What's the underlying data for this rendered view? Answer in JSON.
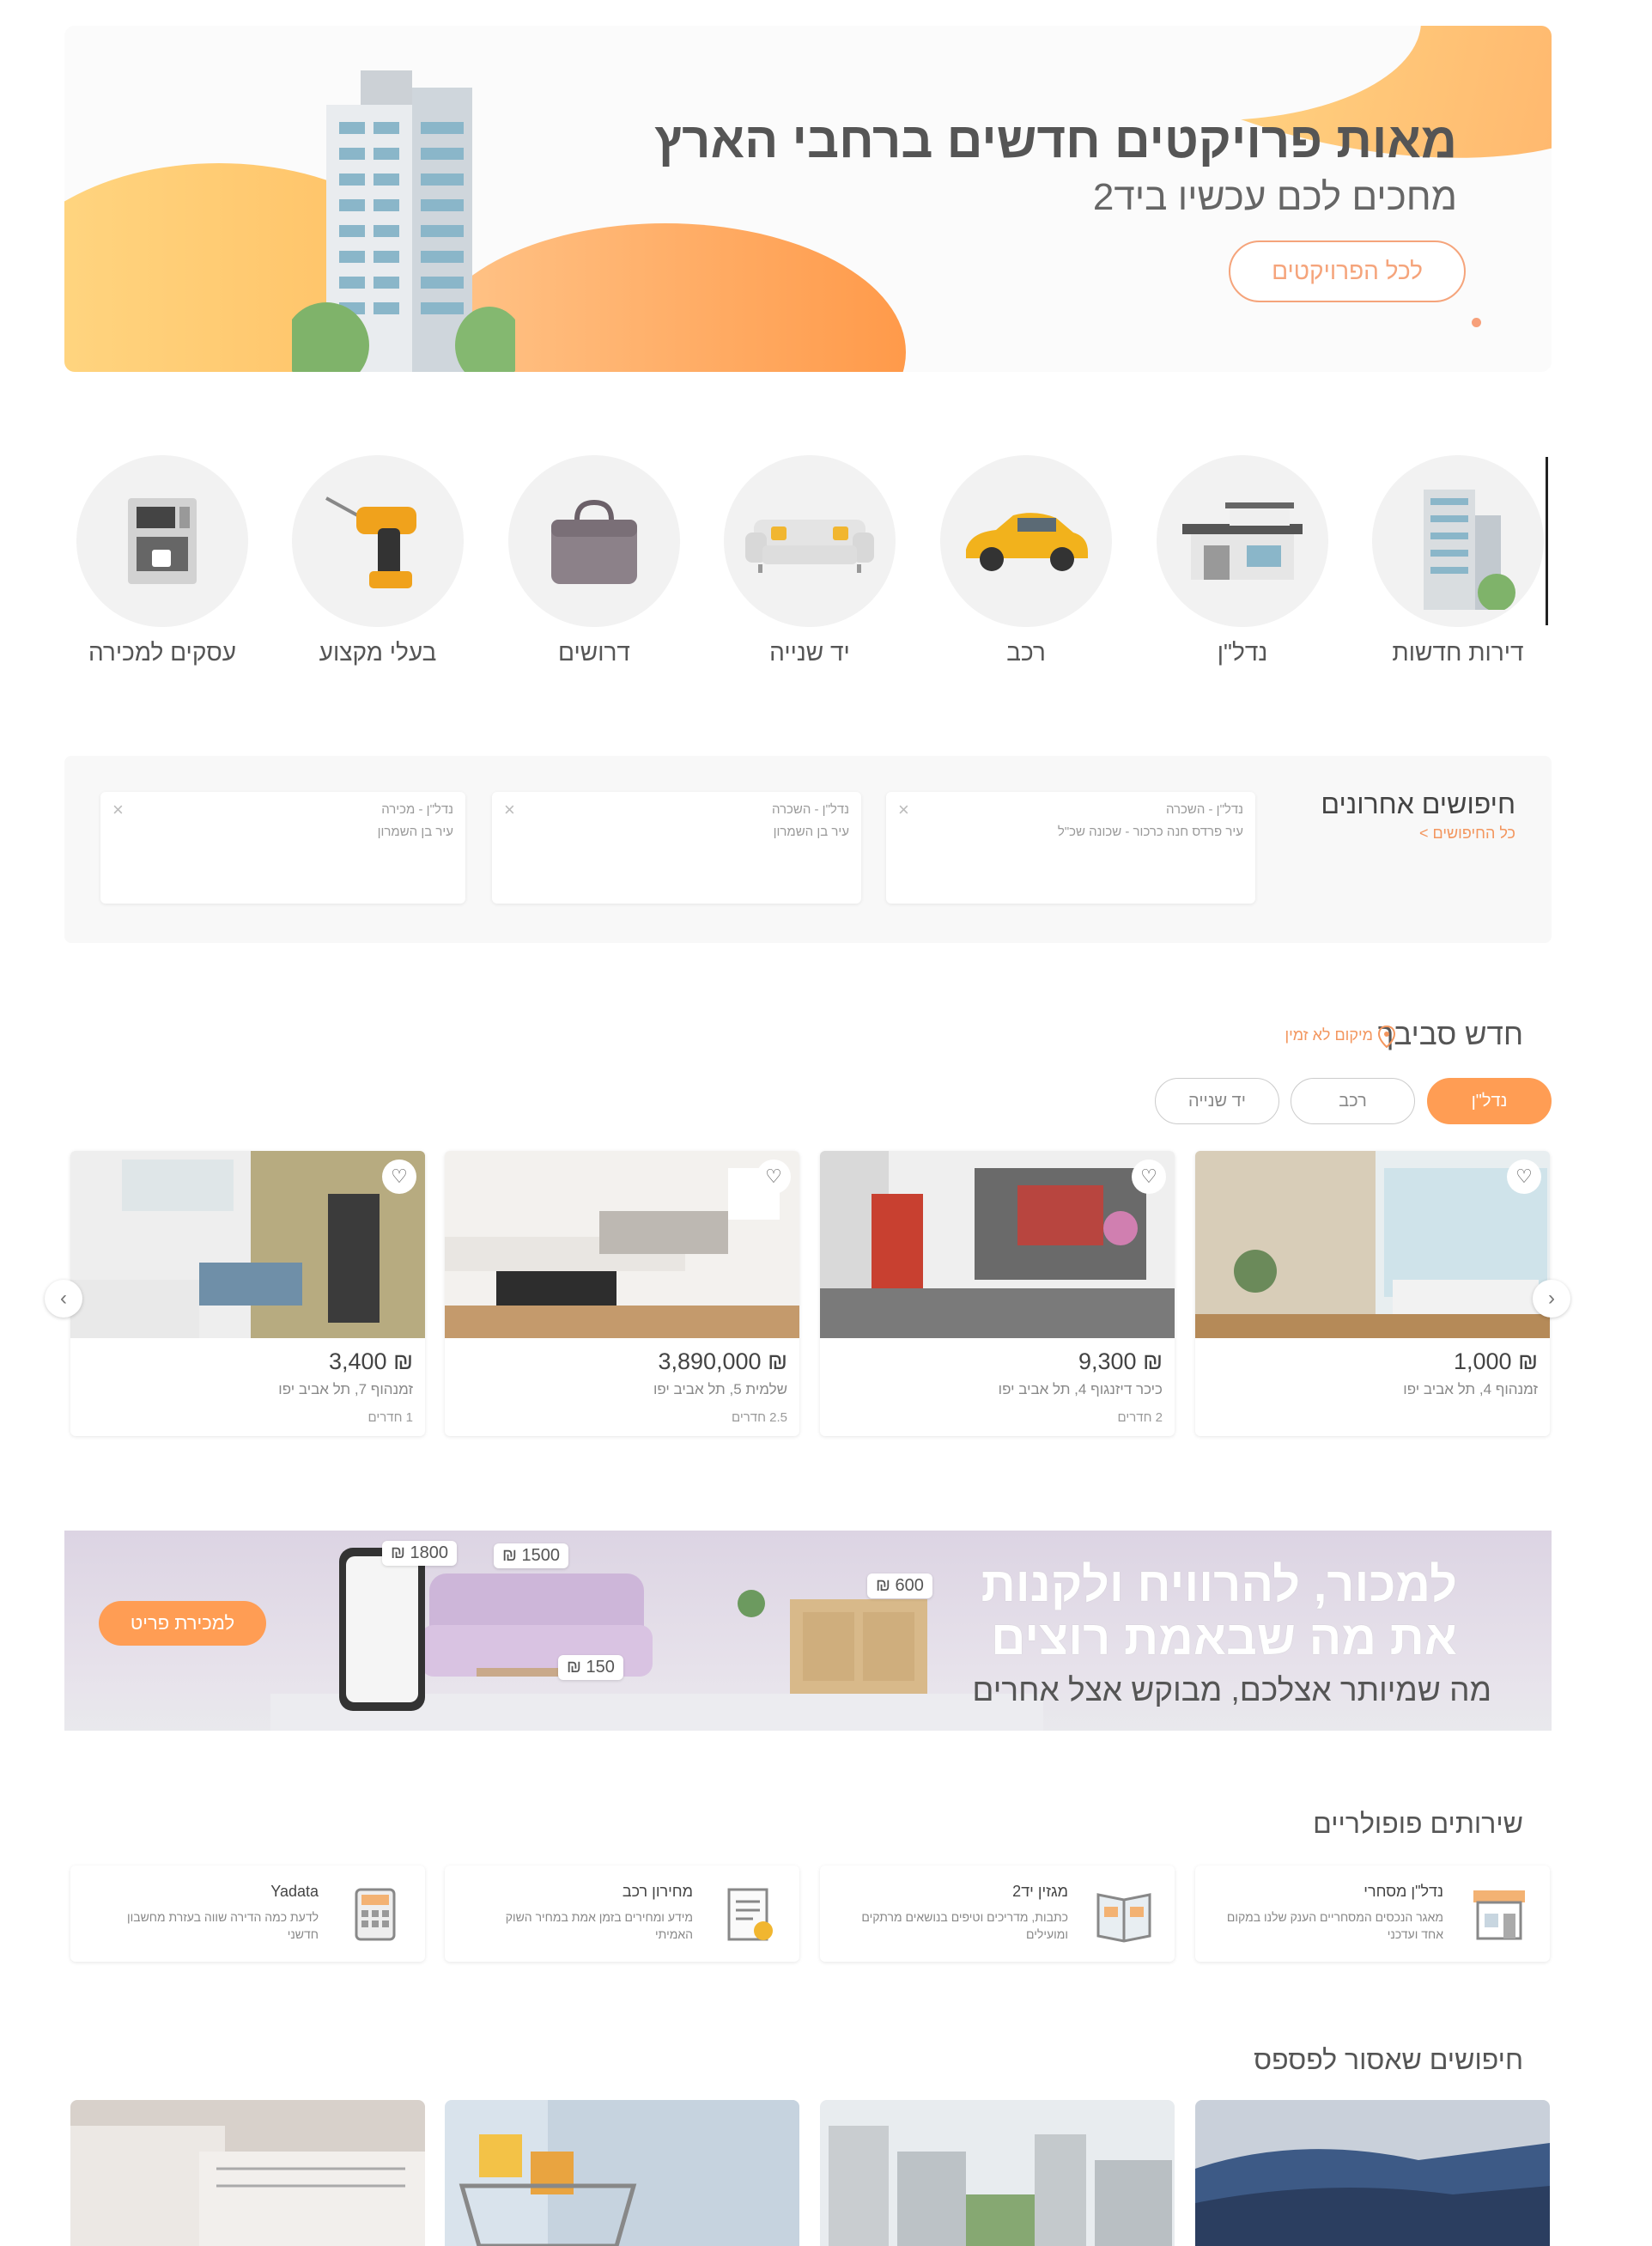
{
  "hero": {
    "title": "מאות פרויקטים חדשים ברחבי הארץ",
    "subtitle": "מחכים לכם עכשיו ביד2",
    "cta_label": "לכל הפרויקטים"
  },
  "categories": [
    {
      "label": "דירות חדשות",
      "icon": "building-icon"
    },
    {
      "label": "נדל\"ן",
      "icon": "house-icon"
    },
    {
      "label": "רכב",
      "icon": "car-icon"
    },
    {
      "label": "יד שנייה",
      "icon": "sofa-icon"
    },
    {
      "label": "דרושים",
      "icon": "briefcase-icon"
    },
    {
      "label": "בעלי מקצוע",
      "icon": "drill-icon"
    },
    {
      "label": "עסקים למכירה",
      "icon": "coffee-machine-icon"
    }
  ],
  "recent_searches": {
    "title": "חיפושים אחרונים",
    "all_link": "כל החיפושים >",
    "items": [
      {
        "line1": "נדל\"ן - השכרה",
        "line2": "עיר פרדס חנה כרכור - שכונה שכ\"ל"
      },
      {
        "line1": "נדל\"ן - השכרה",
        "line2": "עיר בן השמרון"
      },
      {
        "line1": "נדל\"ן - מכירה",
        "line2": "עיר בן השמרון"
      }
    ]
  },
  "nearby": {
    "title": "חדש סביבך",
    "location_text": "מיקום לא זמין",
    "chips": [
      {
        "label": "נדל\"ן",
        "active": true
      },
      {
        "label": "רכב",
        "active": false
      },
      {
        "label": "יד שנייה",
        "active": false
      }
    ],
    "listings": [
      {
        "price": "₪ 1,000",
        "address": "זמנהוף 4, תל אביב יפו",
        "rooms": ""
      },
      {
        "price": "₪ 9,300",
        "address": "כיכר דיזנגוף 4, תל אביב יפו",
        "rooms": "2 חדרים"
      },
      {
        "price": "₪ 3,890,000",
        "address": "שלמית 5, תל אביב יפו",
        "rooms": "2.5 חדרים"
      },
      {
        "price": "₪ 3,400",
        "address": "זמנהוף 7, תל אביב יפו",
        "rooms": "1 חדרים"
      }
    ]
  },
  "promo": {
    "line1": "למכור, להרוויח ולקנות",
    "line2": "את מה שבאמת רוצים",
    "line3": "מה שמיותר אצלכם, מבוקש אצל אחרים",
    "button": "למכירת פריט",
    "tags": [
      "₪ 1800",
      "₪ 1500",
      "₪ 600",
      "₪ 150"
    ]
  },
  "services": {
    "title": "שירותים פופולריים",
    "items": [
      {
        "title": "נדל\"ן מסחרי",
        "desc": "מאגר הנכסים המסחריים הענק שלנו במקום אחד ועדכני",
        "icon": "storefront-icon"
      },
      {
        "title": "מגזין יד2",
        "desc": "כתבות, מדריכים וטיפים בנושאים מרתקים ומועילים",
        "icon": "magazine-icon"
      },
      {
        "title": "מחירון רכב",
        "desc": "מידע ומחירים בזמן אמת במחיר השוק האמיתי",
        "icon": "price-list-icon"
      },
      {
        "title": "Yadata",
        "desc": "לדעת כמה הדירה שווה בעזרת מחשבון חדשני",
        "icon": "calculator-icon"
      }
    ]
  },
  "dont_miss": {
    "title": "חיפושים שאסור לפספס",
    "items": [
      {
        "icon": "cars-image"
      },
      {
        "icon": "city-image"
      },
      {
        "icon": "shopping-cart-image"
      },
      {
        "icon": "newspaper-image"
      }
    ]
  },
  "colors": {
    "accent": "#ff9d54",
    "accent_light": "#f5a47b",
    "text": "#555555"
  }
}
